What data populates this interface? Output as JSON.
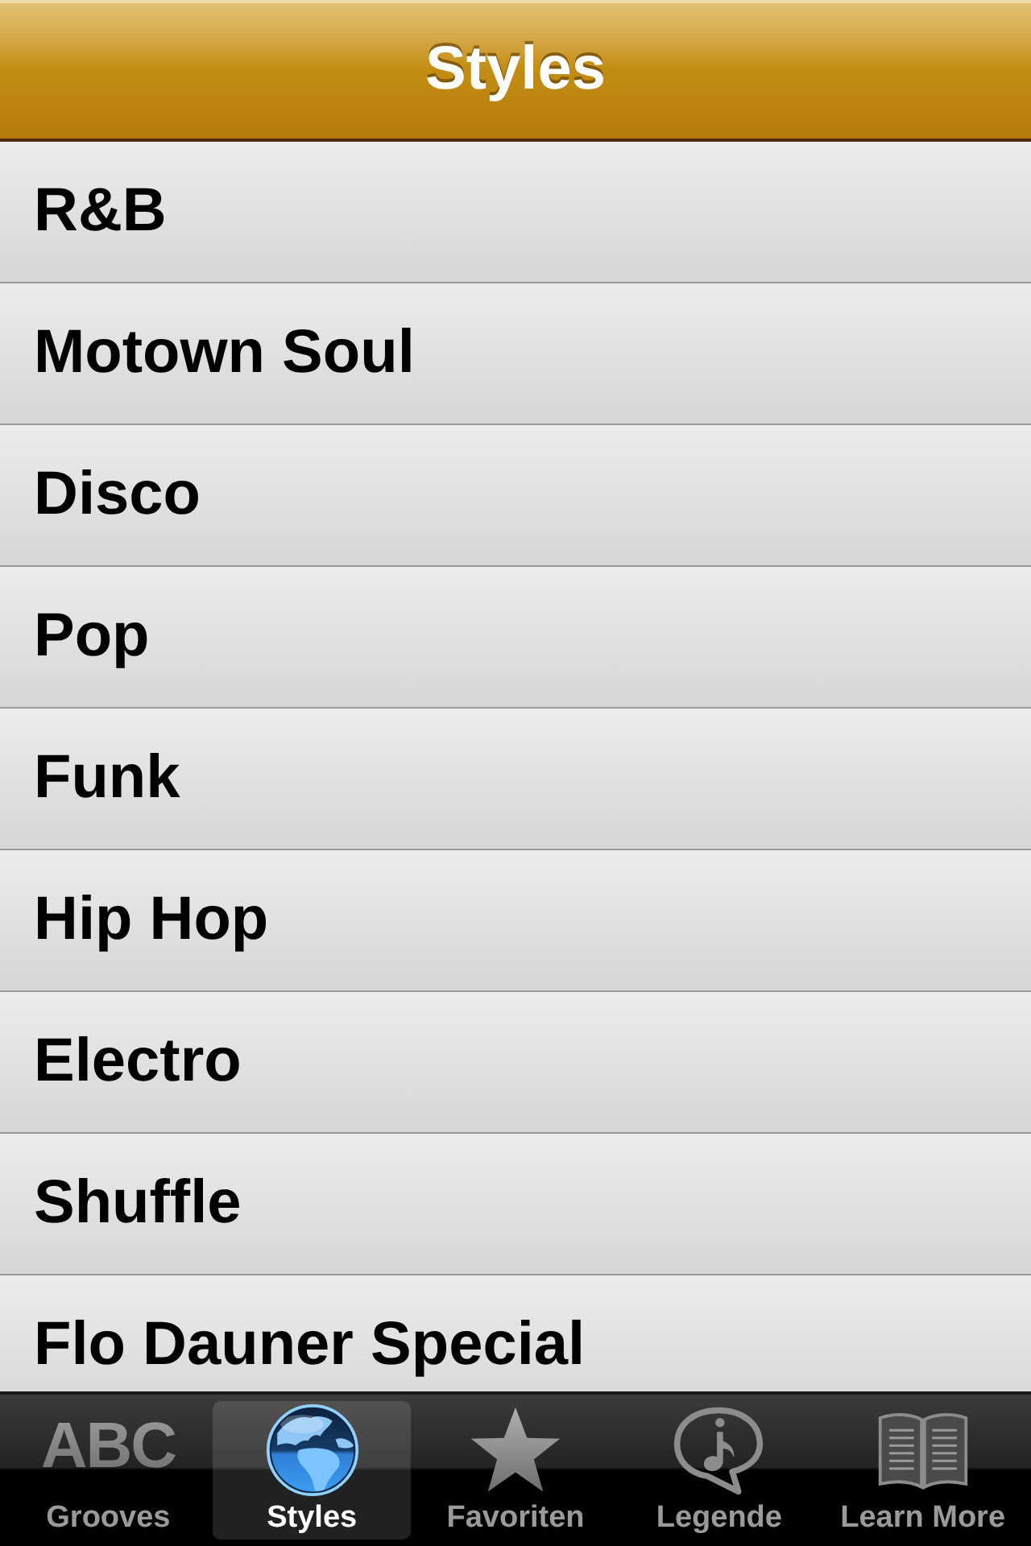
{
  "nav_bar": {
    "title": "Styles"
  },
  "list": {
    "items": [
      {
        "label": "R&B"
      },
      {
        "label": "Motown Soul"
      },
      {
        "label": "Disco"
      },
      {
        "label": "Pop"
      },
      {
        "label": "Funk"
      },
      {
        "label": "Hip Hop"
      },
      {
        "label": "Electro"
      },
      {
        "label": "Shuffle"
      },
      {
        "label": "Flo Dauner Special"
      }
    ]
  },
  "tab_bar": {
    "tabs": [
      {
        "label": "Grooves",
        "kind": "letters",
        "icon_text": "ABC",
        "selected": false
      },
      {
        "label": "Styles",
        "kind": "globe",
        "selected": true
      },
      {
        "label": "Favoriten",
        "kind": "star",
        "selected": false
      },
      {
        "label": "Legende",
        "kind": "bubble",
        "selected": false
      },
      {
        "label": "Learn More",
        "kind": "book",
        "selected": false
      }
    ]
  }
}
